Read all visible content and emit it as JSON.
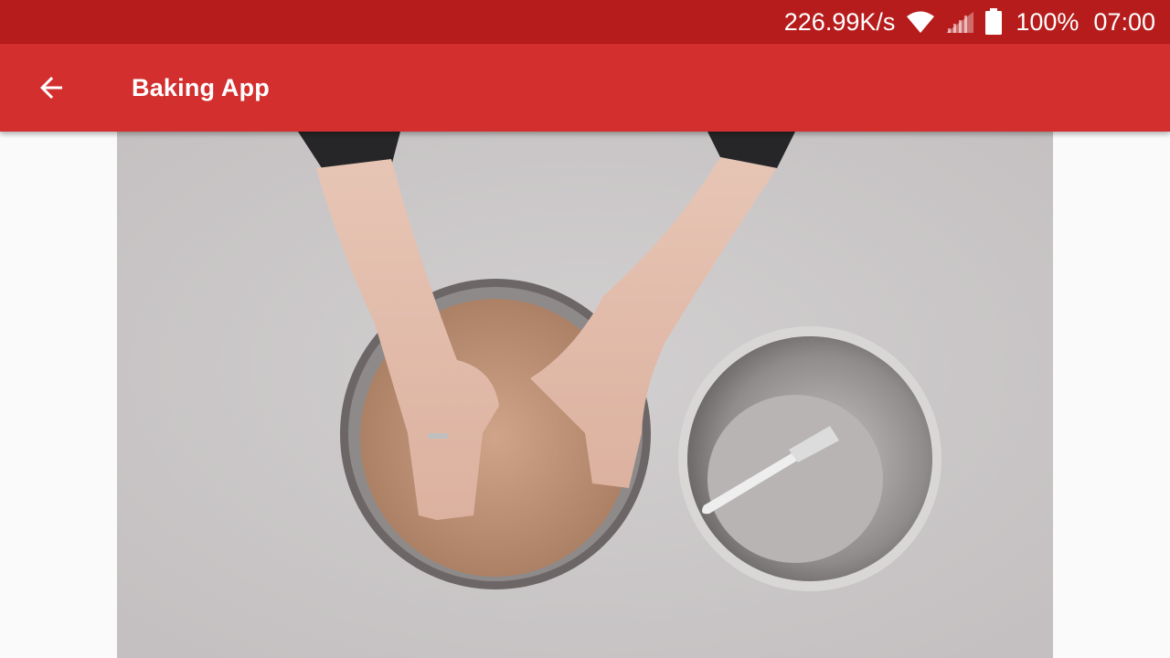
{
  "status_bar": {
    "net_speed": "226.99K/s",
    "battery_percent": "100%",
    "time": "07:00",
    "icons": [
      "wifi-icon",
      "signal-icon",
      "battery-icon"
    ]
  },
  "app_bar": {
    "title": "Baking App",
    "back_icon": "arrow-left-icon"
  },
  "colors": {
    "status_bar": "#b71c1c",
    "app_bar": "#d32f2f",
    "background": "#fafafa"
  }
}
